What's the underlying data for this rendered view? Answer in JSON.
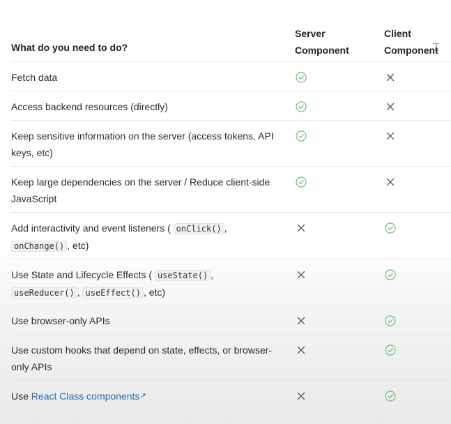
{
  "header": {
    "question": "What do you need to do?",
    "server_line1": "Server",
    "server_line2": "Component",
    "client_line1": "Client",
    "client_line2": "Component"
  },
  "rows": [
    {
      "parts": [
        {
          "t": "Fetch data"
        }
      ],
      "server": "check",
      "client": "cross"
    },
    {
      "parts": [
        {
          "t": "Access backend resources (directly)"
        }
      ],
      "server": "check",
      "client": "cross"
    },
    {
      "parts": [
        {
          "t": "Keep sensitive information on the server (access tokens, API keys, etc)"
        }
      ],
      "server": "check",
      "client": "cross"
    },
    {
      "parts": [
        {
          "t": "Keep large dependencies on the server / Reduce client-side JavaScript"
        }
      ],
      "server": "check",
      "client": "cross"
    },
    {
      "parts": [
        {
          "t": "Add interactivity and event listeners ( "
        },
        {
          "code": "onClick()"
        },
        {
          "t": ", "
        },
        {
          "code": "onChange()"
        },
        {
          "t": ", etc)"
        }
      ],
      "server": "cross",
      "client": "check"
    },
    {
      "parts": [
        {
          "t": "Use State and Lifecycle Effects ( "
        },
        {
          "code": "useState()"
        },
        {
          "t": ", "
        },
        {
          "code": "useReducer()"
        },
        {
          "t": ", "
        },
        {
          "code": "useEffect()"
        },
        {
          "t": ", etc)"
        }
      ],
      "server": "cross",
      "client": "check"
    },
    {
      "parts": [
        {
          "t": "Use browser-only APIs"
        }
      ],
      "server": "cross",
      "client": "check"
    },
    {
      "parts": [
        {
          "t": "Use custom hooks that depend on state, effects, or browser-only APIs"
        }
      ],
      "server": "cross",
      "client": "check"
    },
    {
      "parts": [
        {
          "t": "Use "
        },
        {
          "link": "React Class components"
        }
      ],
      "server": "cross",
      "client": "check"
    }
  ],
  "colors": {
    "check": "#6bbf7b",
    "cross": "#555555",
    "link": "#2a6bb0"
  }
}
